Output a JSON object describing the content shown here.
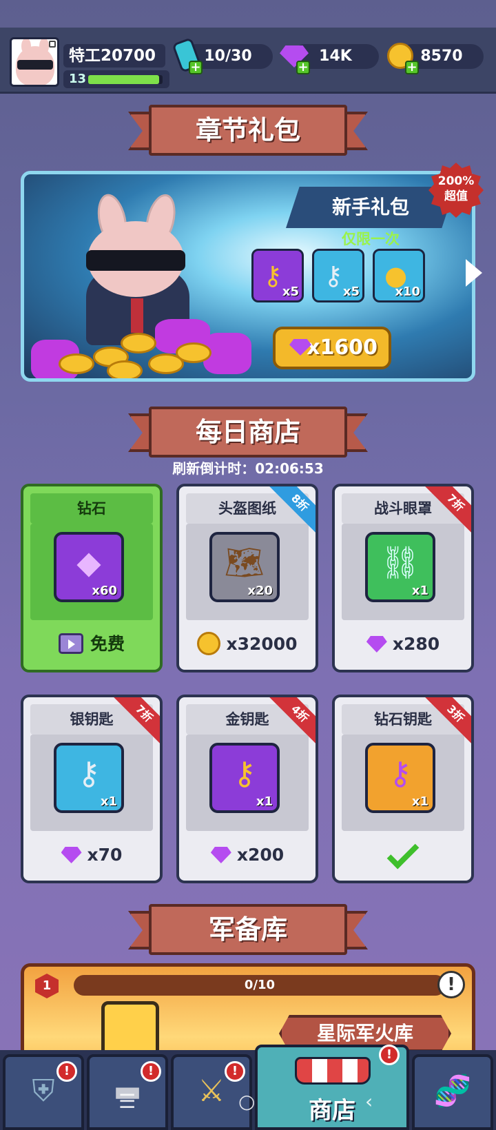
{
  "player": {
    "name": "特工20700",
    "level": "13",
    "xp_fraction": 0.95
  },
  "resources": [
    {
      "name": "energy",
      "value": "10/30",
      "icon": "battery-icon",
      "color": "#39c5d6"
    },
    {
      "name": "gems",
      "value": "14K",
      "icon": "gem-icon",
      "color": "#b54cf0"
    },
    {
      "name": "gold",
      "value": "8570",
      "icon": "coin-icon",
      "color": "#f6c22e"
    }
  ],
  "chapter_pack": {
    "banner": "章节礼包",
    "title": "新手礼包",
    "limit": "仅限一次",
    "badge": "200%\n超值",
    "items": [
      {
        "icon": "gold-key-icon",
        "qty": "x5"
      },
      {
        "icon": "silver-key-icon",
        "qty": "x5"
      },
      {
        "icon": "coin-bag-icon",
        "qty": "x10"
      }
    ],
    "price": "x1600"
  },
  "daily_shop": {
    "banner": "每日商店",
    "refresh": "刷新倒计时：02:06:53",
    "items": [
      {
        "name": "钻石",
        "qty": "x60",
        "cost": "免费",
        "discount": "",
        "currency": "video",
        "icon": "gem-icon"
      },
      {
        "name": "头盔图纸",
        "qty": "x20",
        "cost": "x32000",
        "discount": "8折",
        "currency": "coin",
        "icon": "helmet-blueprint-icon"
      },
      {
        "name": "战斗眼罩",
        "qty": "x1",
        "cost": "x280",
        "discount": "7折",
        "currency": "gem",
        "icon": "eye-mask-icon"
      },
      {
        "name": "银钥匙",
        "qty": "x1",
        "cost": "x70",
        "discount": "7折",
        "currency": "gem",
        "icon": "silver-key-icon"
      },
      {
        "name": "金钥匙",
        "qty": "x1",
        "cost": "x200",
        "discount": "4折",
        "currency": "gem",
        "icon": "gold-key-icon"
      },
      {
        "name": "钻石钥匙",
        "qty": "x1",
        "cost": "",
        "discount": "3折",
        "currency": "purchased",
        "icon": "diamond-key-icon"
      }
    ]
  },
  "armory": {
    "banner": "军备库",
    "level": "1",
    "progress": "0/10",
    "title": "星际军火库"
  },
  "nav": [
    {
      "name": "armor",
      "icon": "armor-icon",
      "badge": "!"
    },
    {
      "name": "weapons",
      "icon": "pistol-icon",
      "badge": "!"
    },
    {
      "name": "battle",
      "icon": "crossed-swords-icon",
      "badge": "!"
    },
    {
      "name": "shop",
      "icon": "shop-icon",
      "badge": "!",
      "label": "商店"
    },
    {
      "name": "dna",
      "icon": "dna-icon",
      "badge": ""
    }
  ]
}
